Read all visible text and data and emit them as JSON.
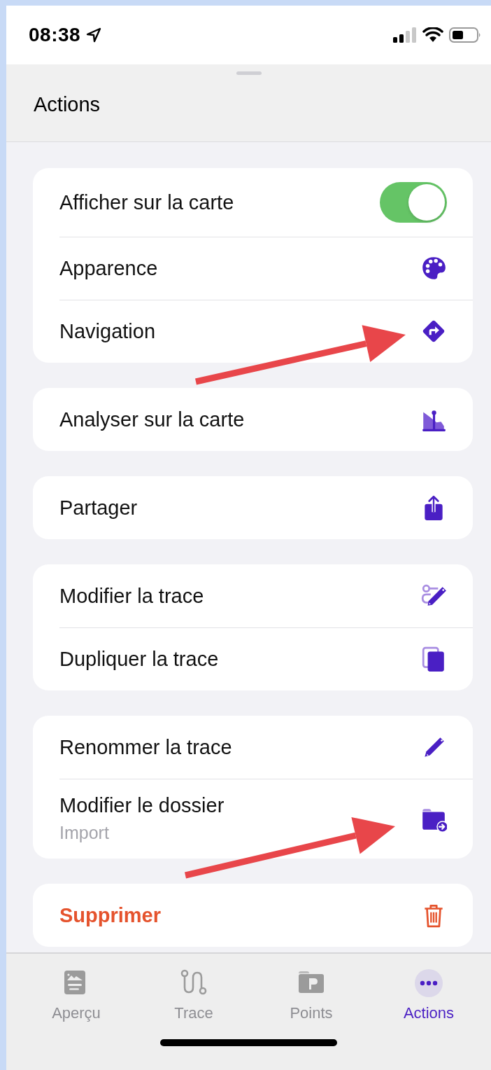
{
  "status_bar": {
    "time": "08:38"
  },
  "sheet": {
    "title": "Actions"
  },
  "groups": [
    {
      "rows": [
        {
          "kind": "toggle",
          "label": "Afficher sur la carte",
          "on": true
        },
        {
          "kind": "icon",
          "label": "Apparence"
        },
        {
          "kind": "icon",
          "label": "Navigation"
        }
      ]
    },
    {
      "rows": [
        {
          "kind": "icon",
          "label": "Analyser sur la carte"
        }
      ]
    },
    {
      "rows": [
        {
          "kind": "icon",
          "label": "Partager"
        }
      ]
    },
    {
      "rows": [
        {
          "kind": "icon",
          "label": "Modifier la trace"
        },
        {
          "kind": "icon",
          "label": "Dupliquer la trace"
        }
      ]
    },
    {
      "rows": [
        {
          "kind": "icon",
          "label": "Renommer la trace"
        },
        {
          "kind": "icon",
          "label": "Modifier le dossier",
          "subtitle": "Import"
        }
      ]
    },
    {
      "rows": [
        {
          "kind": "destructive",
          "label": "Supprimer"
        }
      ]
    }
  ],
  "tab_bar": [
    {
      "label": "Aperçu",
      "selected": false
    },
    {
      "label": "Trace",
      "selected": false
    },
    {
      "label": "Points",
      "selected": false
    },
    {
      "label": "Actions",
      "selected": true
    }
  ]
}
